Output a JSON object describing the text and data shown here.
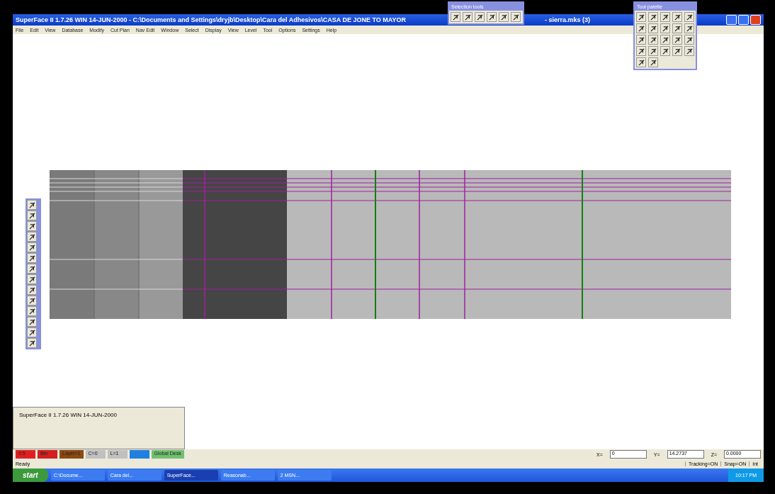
{
  "window": {
    "title": "SuperFace II 1.7.26 WIN 14-JUN-2000 - C:\\Documents and Settings\\dryjb\\Desktop\\Cara del Adhesivos\\CASA DE JONE TO MAYOR",
    "title_tail": "- sierra.mks (3)"
  },
  "menu": [
    "File",
    "Edit",
    "View",
    "Database",
    "Modify",
    "Cut Plan",
    "Nav Edit",
    "Window",
    "Select",
    "Display",
    "View",
    "Level",
    "Tool",
    "Options",
    "Settings",
    "Help"
  ],
  "selection_toolbar": {
    "title": "Selection tools"
  },
  "tool_palette": {
    "title": "Tool palette"
  },
  "command_window": {
    "text": "SuperFace II 1.7.26 WIN 14-JUN-2000"
  },
  "status_chips": [
    {
      "label": "0:5",
      "color": "#e02020"
    },
    {
      "label": "Bin",
      "color": "#d02020"
    },
    {
      "label": "Layer=1",
      "color": "#8b4a10"
    },
    {
      "label": "C=0",
      "color": "#c0c0c0"
    },
    {
      "label": "L=1",
      "color": "#c0c0c0"
    },
    {
      "color": "#2080e0"
    },
    {
      "label": "Global Desk",
      "color": "#70c070"
    }
  ],
  "coordinates": [
    {
      "label": "X=",
      "value": "0"
    },
    {
      "label": "Y=",
      "value": "14.2737"
    },
    {
      "label": "Z=",
      "value": "0.0000"
    }
  ],
  "status_bar": {
    "text": "Ready",
    "panes": [
      "Tracking=ON",
      "Snap=ON",
      "Int"
    ]
  },
  "taskbar": {
    "start": "start",
    "items": [
      {
        "label": "C:\\Docume...",
        "selected": false
      },
      {
        "label": "Cara del...",
        "selected": false
      },
      {
        "label": "SuperFace...",
        "selected": true
      },
      {
        "label": "Reasonab...",
        "selected": false
      },
      {
        "label": "2 MSN...",
        "selected": false
      }
    ],
    "clock": "10:17 PM"
  }
}
